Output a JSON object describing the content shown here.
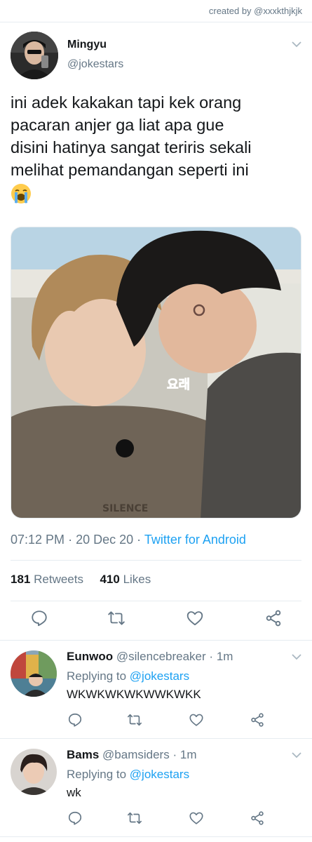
{
  "credit": "created by @xxxkthjkjk",
  "tweet": {
    "name": "Mingyu",
    "handle": "@jokestars",
    "text_lines": [
      "ini adek kakakan tapi kek orang",
      "pacaran anjer ga liat apa gue",
      "disini hatinya sangat teriris sekali",
      "melihat pemandangan seperti ini"
    ],
    "emoji": "loudly-crying-face",
    "image_caption": "요래",
    "image_shirt_text": "SILENCE",
    "time": "07:12 PM",
    "date": "20 Dec 20",
    "separator": "·",
    "source": "Twitter for Android",
    "retweets_count": "181",
    "retweets_label": "Retweets",
    "likes_count": "410",
    "likes_label": "Likes"
  },
  "actions": {
    "icons": [
      "reply-icon",
      "retweet-icon",
      "like-icon",
      "share-icon"
    ]
  },
  "replies": [
    {
      "name": "Eunwoo",
      "handle": "@silencebreaker",
      "time": "1m",
      "replying_prefix": "Replying to",
      "replying_to": "@jokestars",
      "text": "WKWKWKWKWWKWKK"
    },
    {
      "name": "Bams",
      "handle": "@bamsiders",
      "time": "1m",
      "replying_prefix": "Replying to",
      "replying_to": "@jokestars",
      "text": "wk"
    }
  ],
  "colors": {
    "accent": "#1da1f2",
    "secondary_text": "#657786",
    "primary_text": "#14171a",
    "divider": "#e6ecf0"
  }
}
